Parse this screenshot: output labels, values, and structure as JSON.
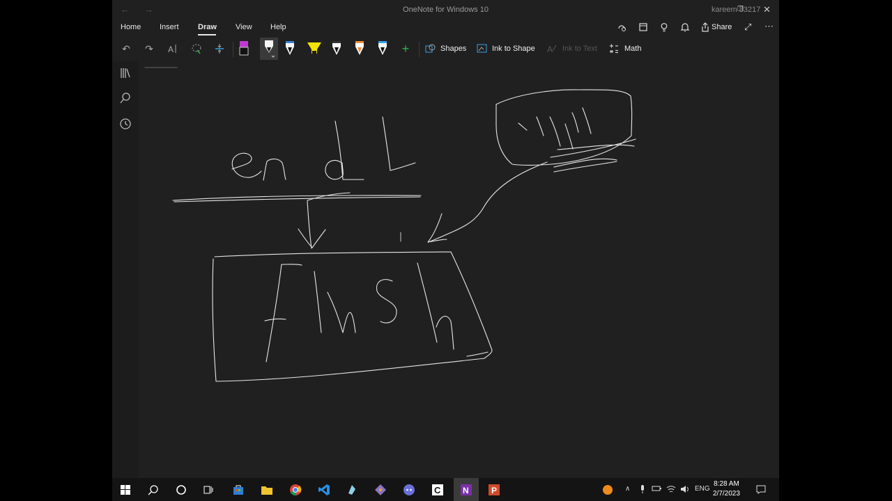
{
  "window": {
    "title": "OneNote for Windows 10",
    "user": "kareem 83217",
    "back_icon": "arrow-left-icon",
    "forward_icon": "arrow-right-icon"
  },
  "ribbon": {
    "tabs": [
      {
        "label": "Home"
      },
      {
        "label": "Insert"
      },
      {
        "label": "Draw"
      },
      {
        "label": "View"
      },
      {
        "label": "Help"
      }
    ],
    "active_tab": "Draw",
    "share_label": "Share"
  },
  "draw_toolbar": {
    "shapes_label": "Shapes",
    "ink_to_shape_label": "Ink to Shape",
    "ink_to_text_label": "Ink to Text",
    "math_label": "Math",
    "pen_colors": [
      "#b03fbf",
      "#ffffff",
      "#ffffff",
      "#f2e600",
      "#ffffff",
      "#e98a3a",
      "#3aa0e9"
    ]
  },
  "canvas": {
    "handwritten_words": [
      "endL",
      "flush",
      "\\n"
    ]
  },
  "taskbar": {
    "language": "ENG",
    "time": "8:28 AM",
    "date": "2/7/2023"
  }
}
